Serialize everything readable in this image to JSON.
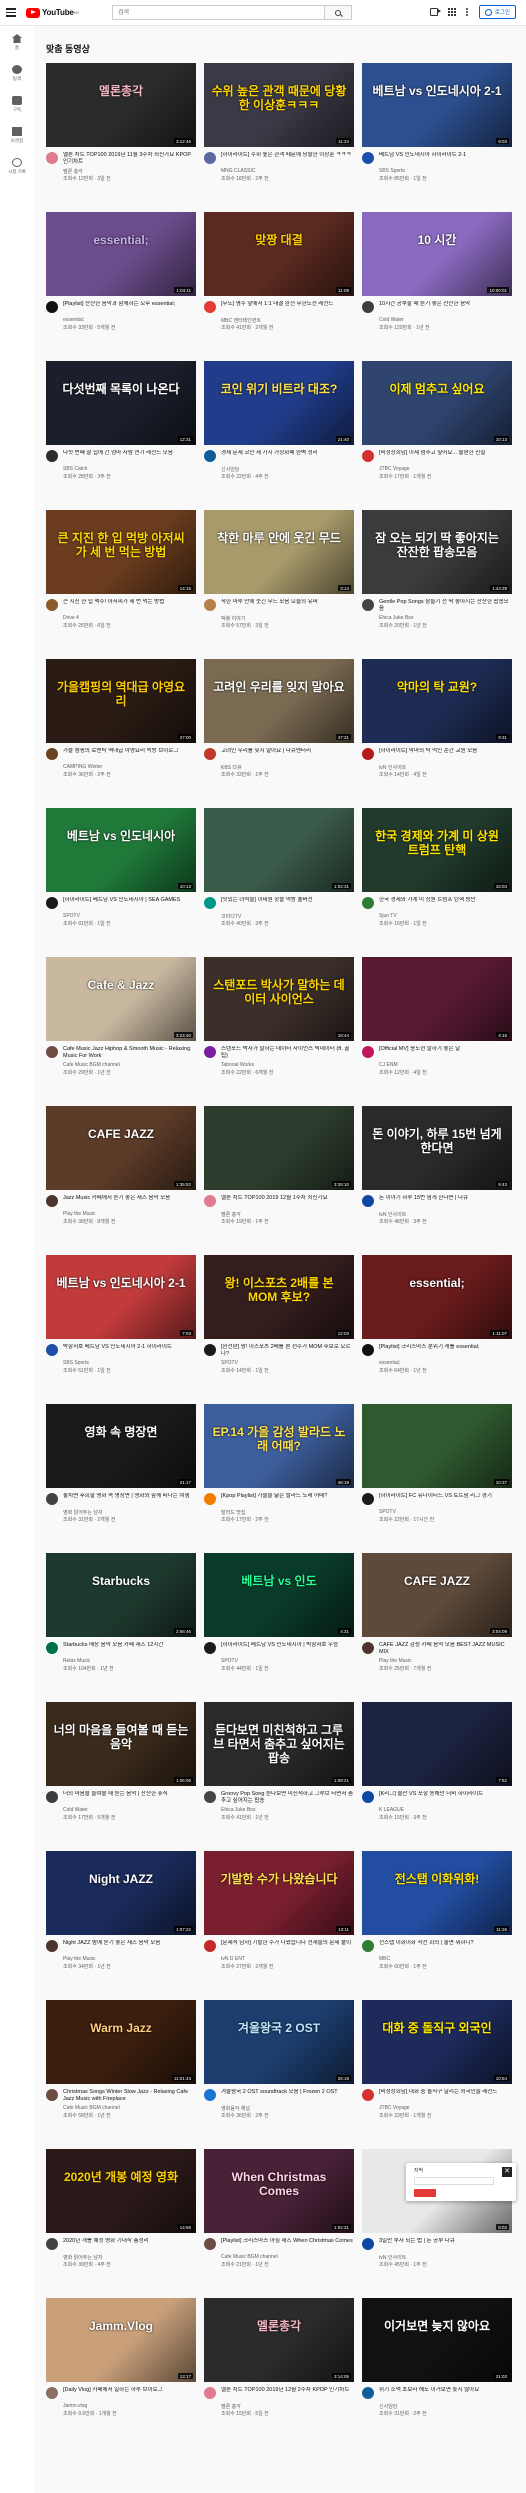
{
  "header": {
    "logo_text": "YouTube",
    "logo_sup": "KR",
    "search_placeholder": "검색",
    "signin_label": "로그인"
  },
  "sidebar": {
    "items": [
      {
        "icon": "home-icon",
        "label": "홈"
      },
      {
        "icon": "explore-icon",
        "label": "탐색"
      },
      {
        "icon": "subscriptions-icon",
        "label": "구독"
      },
      {
        "icon": "library-icon",
        "label": "보관함"
      },
      {
        "icon": "history-icon",
        "label": "시청 기록"
      }
    ]
  },
  "section": {
    "title": "맞춤 동영상"
  },
  "videos": [
    {
      "title": "멜론 차트 TOP100 2019년 11월 3주차 최신가요 KPOP 인기차트",
      "channel": "멜론 총각",
      "stats": "조회수 12만회 · 3일 전",
      "thumb_text": "멜론총각",
      "bg": "#2b2b2b",
      "accent": "#f4b6c2",
      "duration": "3:12:45",
      "ava": "#e07a8f"
    },
    {
      "title": "[하이라이트] 수위 높은 관객 때문에 당황한 이상훈 ㅋㅋㅋ",
      "channel": "MNG CLASSIC",
      "stats": "조회수 18만회 · 2주 전",
      "thumb_text": "수위 높은 관객 때문에 당황한 이상훈ㅋㅋㅋ",
      "bg": "#3a3a46",
      "accent": "#ffd400",
      "duration": "11:24",
      "ava": "#5a6aa0"
    },
    {
      "title": "베트남 VS 인도네시아 하이라이트 2-1",
      "channel": "SBS Sports",
      "stats": "조회수 85만회 · 1일 전",
      "thumb_text": "베트남 vs 인도네시아 2-1",
      "bg": "#2c4f8f",
      "accent": "#ffffff",
      "duration": "9:03",
      "ava": "#1d4ea8"
    },
    {
      "title": "[Playlist] 잔잔한 음악과 함께하는 오후 essential;",
      "channel": "essential;",
      "stats": "조회수 33만회 · 5개월 전",
      "thumb_text": "essential;",
      "bg": "#6b4d8d",
      "accent": "#c9b2e8",
      "duration": "1:04:11",
      "ava": "#111111"
    },
    {
      "title": "[무도] 명수 앞에서 1:1 대결 완전 무한도전 레전드",
      "channel": "MBC 엔터테인먼트",
      "stats": "조회수 41만회 · 2개월 전",
      "thumb_text": "맞짱 대결",
      "bg": "#5a2a20",
      "accent": "#ffcc00",
      "duration": "11:08",
      "ava": "#e53935"
    },
    {
      "title": "10시간 공부할 때 듣기 좋은 잔잔한 음악",
      "channel": "Cold Water",
      "stats": "조회수 120만회 · 1년 전",
      "thumb_text": "10 시간",
      "bg": "#8a6ac0",
      "accent": "#ffffff",
      "duration": "10:00:01",
      "ava": "#3e3e3e"
    },
    {
      "title": "다섯 번째 딸 집에 간 엄마 사람 연기 레전드 모음",
      "channel": "SBS Catch",
      "stats": "조회수 28만회 · 3주 전",
      "thumb_text": "다섯번째 목록이 나온다",
      "bg": "#1b1f2b",
      "accent": "#ffffff",
      "duration": "12:31",
      "ava": "#2c2c2c"
    },
    {
      "title": "경제 문제 코인 세 가지 가상화폐 완벽 정리",
      "channel": "신사임당",
      "stats": "조회수 22만회 · 4주 전",
      "thumb_text": "코인 위기 비트라 대조?",
      "bg": "#203c8a",
      "accent": "#ffe14d",
      "duration": "21:40",
      "ava": "#0f5e99"
    },
    {
      "title": "[비정상회담] 이제 멈추고 싶어요... 불편한 진실",
      "channel": "JTBC Voyage",
      "stats": "조회수 17만회 · 1개월 전",
      "thumb_text": "이제 멈추고 싶어요",
      "bg": "#2f4570",
      "accent": "#ffe600",
      "duration": "10:13",
      "ava": "#d32f2f"
    },
    {
      "title": "큰 지진 한 입 맥주! 아저씨가 세 번 먹는 방법",
      "channel": "Drive 4",
      "stats": "조회수 26만회 · 6일 전",
      "thumb_text": "큰 지진 한 입 먹방 아저씨가 세 번 먹는 방법",
      "bg": "#6b3d1e",
      "accent": "#ffd700",
      "duration": "14:15",
      "ava": "#8b5a2b"
    },
    {
      "title": "착한 마루 안에 웃긴 무드 모음 오늘의 유머",
      "channel": "박봉 이야기",
      "stats": "조회수 57만회 · 3일 전",
      "thumb_text": "착한 마루 안에 웃긴 무드",
      "bg": "#a89a6a",
      "accent": "#ffffff",
      "duration": "3:14",
      "ava": "#b57f4a"
    },
    {
      "title": "Gentle Pop Songs 잠들기 전 딱 좋아지는 잔잔한 팝송모음",
      "channel": "Ehica Juke Box",
      "stats": "조회수 20만회 · 1년 전",
      "thumb_text": "잠 오는 되기 딱 좋아지는 잔잔한 팝송모음",
      "bg": "#3b3b3b",
      "accent": "#ffffff",
      "duration": "1:43:28",
      "ava": "#444444"
    },
    {
      "title": "가을 캠핑의 로맨틱 역대급 야영요리 먹방 브이로그",
      "channel": "CAMPING Winter",
      "stats": "조회수 36만회 · 2주 전",
      "thumb_text": "가을캠핑의 역대급 야영요리",
      "bg": "#2a1c14",
      "accent": "#ffcc00",
      "duration": "27:00",
      "ava": "#6b4423"
    },
    {
      "title": "고려인 우리를 잊지 말아요 | 다큐멘터리",
      "channel": "KBS 다큐",
      "stats": "조회수 33만회 · 1주 전",
      "thumb_text": "고려인 우리를 잊지 말아요",
      "bg": "#7a6a52",
      "accent": "#ffffff",
      "duration": "47:31",
      "ava": "#c0392b"
    },
    {
      "title": "[하이라이트] 악마의 탁 먹인 순간 교원 모음",
      "channel": "tvN 인사이트",
      "stats": "조회수 14만회 · 4일 전",
      "thumb_text": "악마의 탁 교원?",
      "bg": "#1e2c54",
      "accent": "#ffde00",
      "duration": "9:31",
      "ava": "#b71c1c"
    },
    {
      "title": "[하이라이트] 베트남 VS 인도네시아 | SEA GAMES",
      "channel": "SPOTV",
      "stats": "조회수 81만회 · 1일 전",
      "thumb_text": "베트남 vs 인도네시아",
      "bg": "#1f7a3a",
      "accent": "#ffffff",
      "duration": "10:13",
      "ava": "#1b1b1b"
    },
    {
      "title": "[맛있는 녀석들] 이태원 핫플 먹방 풀버전",
      "channel": "코미디TV",
      "stats": "조회수 40만회 · 3주 전",
      "thumb_text": "",
      "bg": "#3a5a4a",
      "accent": "#ffffff",
      "duration": "1:02:31",
      "ava": "#009688"
    },
    {
      "title": "한국 경제와 가계 미 상원 트럼프 탄핵 방안",
      "channel": "Sjun TV",
      "stats": "조회수 16만회 · 1일 전",
      "thumb_text": "한국 경제와 가계 미 상원 트럼프 탄핵",
      "bg": "#213a2c",
      "accent": "#ffe400",
      "duration": "16:03",
      "ava": "#2e7d32"
    },
    {
      "title": "Cafe Music Jazz Hiphop & Smooth Music - Relaxing Music For Work",
      "channel": "Cafe Music BGM channel",
      "stats": "조회수 29만회 · 1년 전",
      "thumb_text": "Cafe & Jazz",
      "bg": "#c9b8a0",
      "accent": "#ffffff",
      "duration": "3:24:40",
      "ava": "#6d4c41"
    },
    {
      "title": "스탠포드 박사가 말하는 데이터 사이언스 빅데이터 (ft. 꿀팁)",
      "channel": "Tabooal Works",
      "stats": "조회수 22만회 · 6개월 전",
      "thumb_text": "스탠포드 박사가 말하는 데이터 사이언스",
      "bg": "#3c2f2a",
      "accent": "#ffd500",
      "duration": "18:44",
      "ava": "#7b1fa2"
    },
    {
      "title": "[Official MV] 윤도현 말하기 좋은 날",
      "channel": "CJ ENM",
      "stats": "조회수 12만회 · 4일 전",
      "thumb_text": "",
      "bg": "#5a1a34",
      "accent": "#ff7aa8",
      "duration": "4:16",
      "ava": "#c2185b"
    },
    {
      "title": "Jazz Music 카페에서 듣기 좋은 재즈 음악 모음",
      "channel": "Play the Music",
      "stats": "조회수 38만회 · 8개월 전",
      "thumb_text": "CAFE JAZZ",
      "bg": "#5c3b28",
      "accent": "#ffffff",
      "duration": "1:35:52",
      "ava": "#4e342e"
    },
    {
      "title": "멜론 차트 TOP100 2019 12월 1주차 최신가요",
      "channel": "멜론 총각",
      "stats": "조회수 19만회 · 1주 전",
      "thumb_text": "",
      "bg": "#2d3d2d",
      "accent": "#39ff6a",
      "duration": "3:26:10",
      "ava": "#e07a8f"
    },
    {
      "title": "돈 이야기 하루 15번 넘게 한다면 | 다큐",
      "channel": "tvN 인사이트",
      "stats": "조회수 48만회 · 3주 전",
      "thumb_text": "돈 이야기, 하루 15번 넘게 한다면",
      "bg": "#2a2a2a",
      "accent": "#ffffff",
      "duration": "9:43",
      "ava": "#0d47a1"
    },
    {
      "title": "박항서호 베트남 VS 인도네시아 2-1 하이라이트",
      "channel": "SBS Sports",
      "stats": "조회수 51만회 · 1일 전",
      "thumb_text": "베트남 vs 인도네시아 2-1",
      "bg": "#c23b3b",
      "accent": "#ffffff",
      "duration": "7:03",
      "ava": "#1d4ea8"
    },
    {
      "title": "[완전판] 왕! 이스포츠 2배를 본 선수가 MOM 후보로 오르나?",
      "channel": "SPOTV",
      "stats": "조회수 14만회 · 1일 전",
      "thumb_text": "왕! 이스포츠 2배를 본 MOM 후보?",
      "bg": "#341d1d",
      "accent": "#ffd700",
      "duration": "12:03",
      "ava": "#1b1b1b"
    },
    {
      "title": "[Playlist] 크리스마스 분위기 캐롤 essential;",
      "channel": "essential;",
      "stats": "조회수 64만회 · 1년 전",
      "thumb_text": "essential;",
      "bg": "#6a1b1b",
      "accent": "#ffffff",
      "duration": "1:11:07",
      "ava": "#111111"
    },
    {
      "title": "놓치면 후회할 영화 속 명장면 | 영화와 함께 떠나는 여행",
      "channel": "영화 읽어주는 남자",
      "stats": "조회수 31만회 · 2개월 전",
      "thumb_text": "영화 속 명장면",
      "bg": "#1a1a1a",
      "accent": "#ffffff",
      "duration": "21:17",
      "ava": "#424242"
    },
    {
      "title": "[Kpop Playlist] 가을을 닮은 발라드 노래 어때?",
      "channel": "발라드 맛집",
      "stats": "조회수 17만회 · 2주 전",
      "thumb_text": "EP.14 가을 감성 발라드 노래 어때?",
      "bg": "#3d5e9c",
      "accent": "#ffe14d",
      "duration": "46:19",
      "ava": "#f57c00"
    },
    {
      "title": "[하이라이트] FC 유나이티드 VS 토트넘 리그 경기",
      "channel": "SPOTV",
      "stats": "조회수 22만회 · 17시간 전",
      "thumb_text": "",
      "bg": "#2f5a2f",
      "accent": "#ffffff",
      "duration": "10:37",
      "ava": "#1b1b1b"
    },
    {
      "title": "Starbucks 매장 음악 모음 카페 재즈 12시간",
      "channel": "Relax Music",
      "stats": "조회수 104만회 · 1년 전",
      "thumb_text": "Starbucks",
      "bg": "#1e3a2e",
      "accent": "#ffffff",
      "duration": "2:56:46",
      "ava": "#00704a"
    },
    {
      "title": "[하이라이트] 베트남 VS 인도네시아 | 박항서호 우승",
      "channel": "SPOTV",
      "stats": "조회수 44만회 · 1일 전",
      "thumb_text": "베트남 vs 인도",
      "bg": "#0a3a2a",
      "accent": "#26ff9a",
      "duration": "4:31",
      "ava": "#1b1b1b"
    },
    {
      "title": "CAFE JAZZ 감성 카페 음악 모음 BEST JAZZ MUSIC MIX",
      "channel": "Play the Music",
      "stats": "조회수 25만회 · 7개월 전",
      "thumb_text": "CAFE JAZZ",
      "bg": "#5e4a3a",
      "accent": "#ffffff",
      "duration": "3:04:09",
      "ava": "#4e342e"
    },
    {
      "title": "너의 마음을 들여볼 때 듣는 음악 | 잔잔한 휴식",
      "channel": "Cold Water",
      "stats": "조회수 17만회 · 5개월 전",
      "thumb_text": "너의 마음을 들여볼 때 듣는 음악",
      "bg": "#3a2a1c",
      "accent": "#ffffff",
      "duration": "1:06:05",
      "ava": "#3e3e3e"
    },
    {
      "title": "Groovy Pop Song 듣다보면 미친척하고 그루브 타면서 춤추고 싶어지는 팝송",
      "channel": "Ehica Juke Box",
      "stats": "조회수 41만회 · 1년 전",
      "thumb_text": "듣다보면 미친척하고 그루브 타면서 춤추고 싶어지는 팝송",
      "bg": "#2a2a2a",
      "accent": "#ffffff",
      "duration": "1:08:21",
      "ava": "#444444"
    },
    {
      "title": "[K리그] 울산 VS 포항 동해안 더비 하이라이트",
      "channel": "K LEAGUE",
      "stats": "조회수 15만회 · 3주 전",
      "thumb_text": "",
      "bg": "#1c2340",
      "accent": "#ffffff",
      "duration": "7:52",
      "ava": "#0d47a1"
    },
    {
      "title": "Night JAZZ 밤에 듣기 좋은 재즈 음악 모음",
      "channel": "Play the Music",
      "stats": "조회수 34만회 · 1년 전",
      "thumb_text": "Night JAZZ",
      "bg": "#1a2a5a",
      "accent": "#ffffff",
      "duration": "1:07:22",
      "ava": "#4e342e"
    },
    {
      "title": "[문제적 남자] 기발한 수가 나왔습니다 천재들의 문제 풀이",
      "channel": "tvN D ENT",
      "stats": "조회수 27만회 · 2개월 전",
      "thumb_text": "기발한 수가 나왔습니다",
      "bg": "#7a1f30",
      "accent": "#ffe14d",
      "duration": "13:11",
      "ava": "#c62828"
    },
    {
      "title": "전스탭 이화이화 작전 회의 | 놀면 뭐하니?",
      "channel": "MBC",
      "stats": "조회수 60만회 · 1주 전",
      "thumb_text": "전스탭 이화위화!",
      "bg": "#224da0",
      "accent": "#ffe100",
      "duration": "11:26",
      "ava": "#2e7d32"
    },
    {
      "title": "Christmas Songs Winter Slow Jazz - Relaxing Cafe Jazz Music with Fireplace",
      "channel": "Cafe Music BGM channel",
      "stats": "조회수 58만회 · 1년 전",
      "thumb_text": "Warm Jazz",
      "bg": "#3a1e0e",
      "accent": "#ffcc80",
      "duration": "11:01:43",
      "ava": "#6d4c41"
    },
    {
      "title": "겨울왕국 2 OST soundtrack 모음 | Frozen 2 OST",
      "channel": "영화음악 채널",
      "stats": "조회수 36만회 · 2주 전",
      "thumb_text": "겨울왕국 2 OST",
      "bg": "#1c3d6e",
      "accent": "#bfe8ff",
      "duration": "26:18",
      "ava": "#1976d2"
    },
    {
      "title": "[비정상회담] 대화 중 돌직구 날리는 외국인들 레전드",
      "channel": "JTBC Voyage",
      "stats": "조회수 23만회 · 1개월 전",
      "thumb_text": "대화 중 돌직구 외국인",
      "bg": "#1d2a5a",
      "accent": "#ffe600",
      "duration": "10:54",
      "ava": "#d32f2f"
    },
    {
      "title": "2020년 개봉 예정 영화 기대작 총정리",
      "channel": "영화 읽어주는 남자",
      "stats": "조회수 39만회 · 4주 전",
      "thumb_text": "2020년 개봉 예정 영화",
      "bg": "#2c1a1a",
      "accent": "#ffd000",
      "duration": "14:56",
      "ava": "#424242"
    },
    {
      "title": "[Playlist] 크리스마스 아침 재즈 When Christmas Comes",
      "channel": "Cafe Music BGM channel",
      "stats": "조회수 21만회 · 1년 전",
      "thumb_text": "When Christmas Comes",
      "bg": "#4a2238",
      "accent": "#ffd7e6",
      "duration": "1:02:31",
      "ava": "#6d4c41"
    },
    {
      "title": "3일만 부자 되는 법 | 돈 공부 다큐",
      "channel": "tvN 인사이트",
      "stats": "조회수 45만회 · 1주 전",
      "thumb_text": "",
      "bg": "#e8e8e8",
      "accent": "#222222",
      "duration": "8:02",
      "ava": "#0d47a1"
    },
    {
      "title": "[Daily Vlog] 카페에서 일하는 하루 브이로그",
      "channel": "Jamm.vlog",
      "stats": "조회수 9.6만회 · 1개월 전",
      "thumb_text": "Jamm.Vlog",
      "bg": "#c9a07a",
      "accent": "#ffffff",
      "duration": "13:17",
      "ava": "#8d6e63"
    },
    {
      "title": "멜론 차트 TOP100 2019년 12월 2주차 KPOP 인기차트",
      "channel": "멜론 총각",
      "stats": "조회수 15만회 · 5일 전",
      "thumb_text": "멜론총각",
      "bg": "#2b2b2b",
      "accent": "#f4b6c2",
      "duration": "3:14:05",
      "ava": "#e07a8f"
    },
    {
      "title": "위기 소액 초보라 해도 이거보면 늦지 않아요",
      "channel": "신사임당",
      "stats": "조회수 31만회 · 2주 전",
      "thumb_text": "이거보면 늦지 않아요",
      "bg": "#111111",
      "accent": "#ffffff",
      "duration": "21:03",
      "ava": "#0f5e99"
    }
  ],
  "popup": {
    "label": "자막",
    "close": "✕"
  }
}
